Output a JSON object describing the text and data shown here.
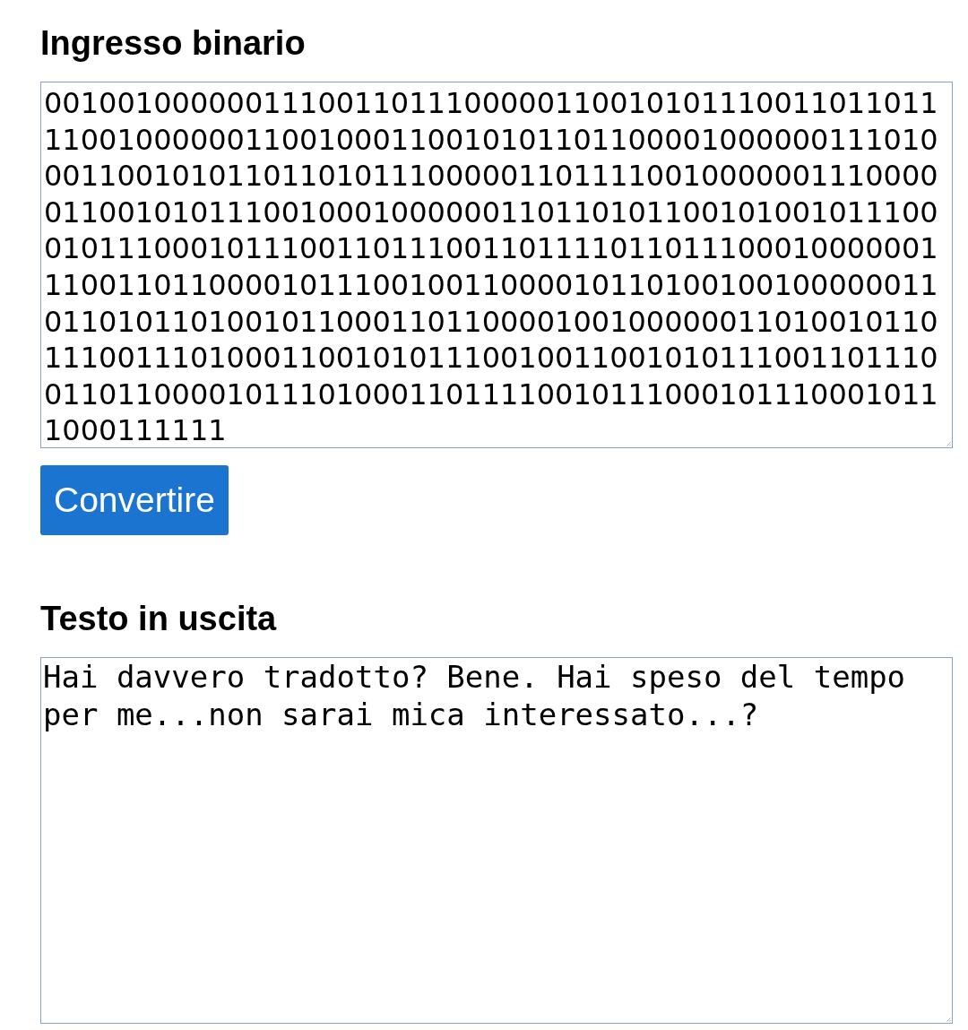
{
  "input_section": {
    "heading": "Ingresso binario",
    "field": {
      "value_lines": [
        "0010010000001110011011100000110010101110011011011",
        "1100100000011001000110010101101100001000000111010",
        "0011001010110110101110000011011110010000001110000",
        "0110010101110010001000000110110101100101001011100",
        "0101110001011100110111001101111011011100010000001",
        "1100110110000101110010011000010110100100100000011",
        "0110101101001011000110110000100100000011010010110",
        "1110011101000110010101110010011001010111001101110",
        "0110110000101110100011011110010111000101110001011",
        "1000111111"
      ]
    }
  },
  "convert_button": {
    "label": "Convertire"
  },
  "output_section": {
    "heading": "Testo in uscita",
    "field": {
      "value": "Hai davvero tradotto? Bene. Hai speso del tempo per me...non sarai mica interessato...?"
    }
  }
}
